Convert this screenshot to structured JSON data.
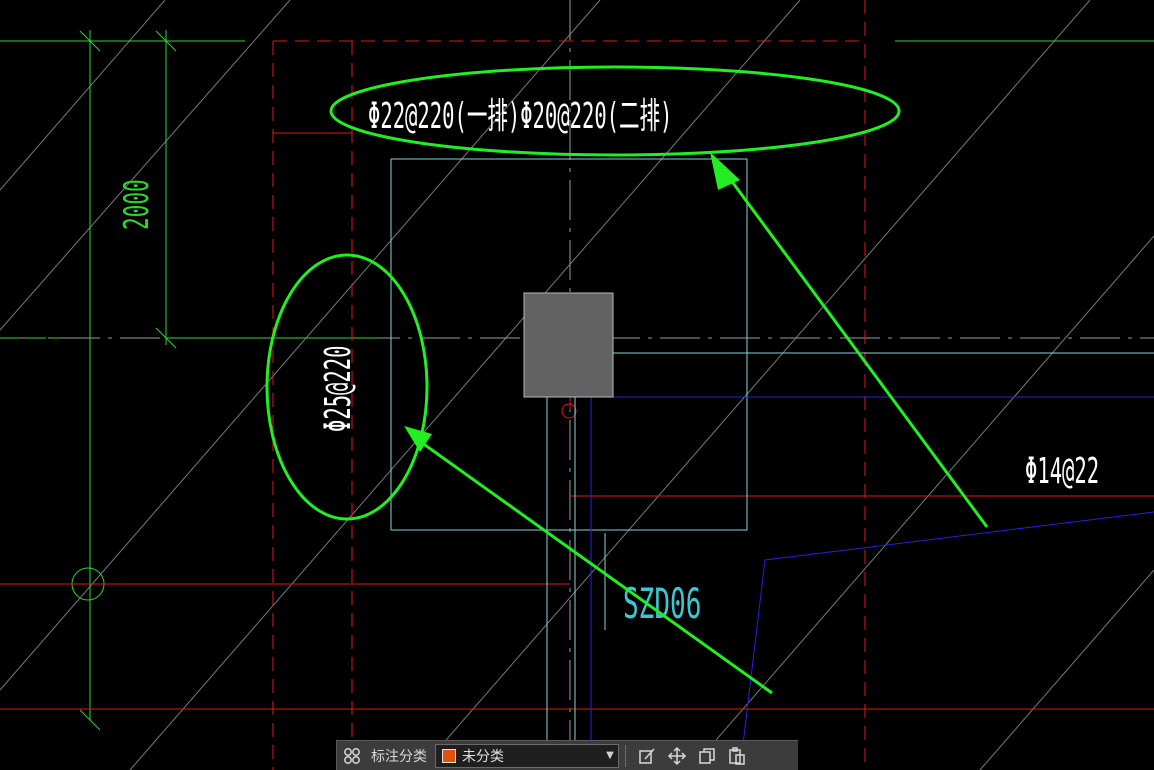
{
  "drawing": {
    "annotation_top": "Φ22@220(一排)Φ20@220(二排)",
    "annotation_left": "Φ25@220",
    "annotation_right": "Φ14@22",
    "dimension": "2000",
    "column_label": "SZD06"
  },
  "colors": {
    "background": "#000000",
    "axis_green": "#2fd62f",
    "highlight_green": "#22ee22",
    "grid_red": "#e01818",
    "outline_cyan": "#7fd3d8",
    "blue_line": "#2020d8",
    "column_fill": "#606060",
    "guide_gray": "#8a8a8a",
    "swatch_orange": "#e2500e"
  },
  "toolbar": {
    "category_label": "标注分类",
    "category_value": "未分类",
    "icons": [
      "grid-icon",
      "edit-icon",
      "move-icon",
      "copy-icon",
      "paste-icon"
    ]
  }
}
